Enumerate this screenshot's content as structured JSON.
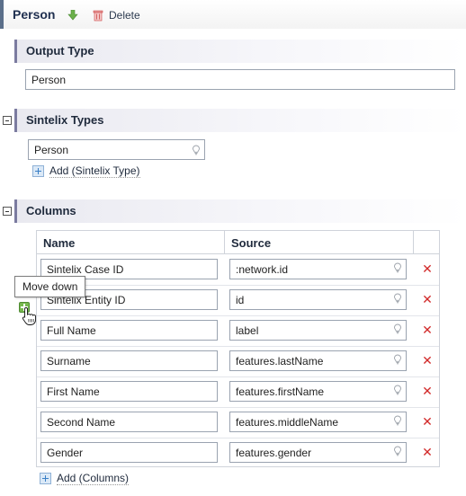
{
  "header": {
    "title": "Person",
    "delete_label": "Delete"
  },
  "output_type": {
    "title": "Output Type",
    "value": "Person"
  },
  "sintelix_types": {
    "title": "Sintelix Types",
    "value": "Person",
    "add_label": "Add (Sintelix Type)"
  },
  "columns": {
    "title": "Columns",
    "headers": [
      "Name",
      "Source"
    ],
    "rows": [
      {
        "name": "Sintelix Case ID",
        "source": ":network.id"
      },
      {
        "name": "Sintelix Entity ID",
        "source": "id"
      },
      {
        "name": "Full Name",
        "source": "label"
      },
      {
        "name": "Surname",
        "source": "features.lastName"
      },
      {
        "name": "First Name",
        "source": "features.firstName"
      },
      {
        "name": "Second Name",
        "source": "features.middleName"
      },
      {
        "name": "Gender",
        "source": "features.gender"
      }
    ],
    "add_label": "Add (Columns)"
  },
  "tooltip": {
    "text": "Move down"
  },
  "icons": {
    "move_down": "green-down-arrow-icon",
    "delete": "trash-icon",
    "remove_row": "red-x-icon",
    "suggest": "lightbulb-icon",
    "add": "plus-icon"
  },
  "colors": {
    "accent": "#7b7ba0",
    "remove": "#d22a2a",
    "move": "#77b84f"
  }
}
